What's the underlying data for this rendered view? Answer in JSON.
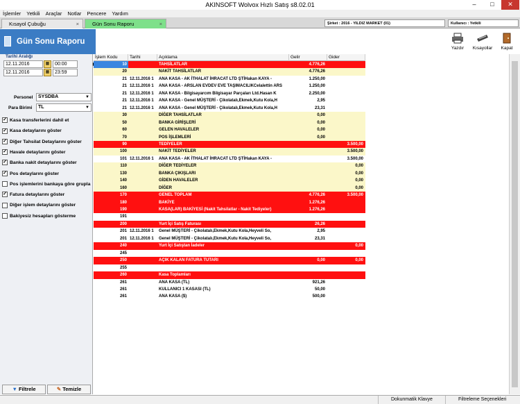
{
  "window": {
    "title": "AKINSOFT Wolvox Hızlı Satış s8.02.01",
    "minimize": "–",
    "maximize": "□",
    "close": "✕"
  },
  "menu": [
    "İşlemler",
    "Yetkili",
    "Araçlar",
    "Notlar",
    "Pencere",
    "Yardım"
  ],
  "tabs": [
    {
      "label": "Kısayol Çubuğu",
      "close": "×"
    },
    {
      "label": "Gün Sonu Raporu",
      "close": "×"
    }
  ],
  "info": {
    "company": "Şirket : 2016 - YILDIZ MARKET (01)",
    "user": "Kullanıcı : Yetkili"
  },
  "banner": {
    "title": "Gün Sonu Raporu"
  },
  "toolbar": {
    "print": "Yazdır",
    "shortcuts": "Kısayollar",
    "close": "Kapat"
  },
  "filters": {
    "date_range_label": "Tarihi Aralığı",
    "start_date": "12.11.2016",
    "start_time": "00:00",
    "end_date": "12.11.2016",
    "end_time": "23:59",
    "personnel_label": "Personel",
    "personnel_value": "SYSDBA",
    "currency_label": "Para Birimi",
    "currency_value": "TL",
    "options": [
      {
        "label": "Kasa transferlerini dahil et",
        "checked": true
      },
      {
        "label": "Kasa detaylarını göster",
        "checked": true
      },
      {
        "label": "Diğer Tahsilat Detaylarını göster",
        "checked": true
      },
      {
        "label": "Havale detaylarını göster",
        "checked": true
      },
      {
        "label": "Banka nakit detaylarını göster",
        "checked": true
      },
      {
        "label": "Pos detaylarını göster",
        "checked": true
      },
      {
        "label": "Pos işlemlerini bankaya göre grupla",
        "checked": false
      },
      {
        "label": "Fatura detaylarını göster",
        "checked": true
      },
      {
        "label": "Diğer işlem detaylarını göster",
        "checked": false
      },
      {
        "label": "Bakiyesiz hesapları gösterme",
        "checked": false
      }
    ],
    "filter_button": "Filtrele",
    "clear_button": "Temizle"
  },
  "grid": {
    "columns": {
      "code": "İşlem Kodu",
      "date": "Tarihi",
      "desc": "Açıklama",
      "gelir": "Gelir",
      "gider": "Gider"
    },
    "rows": [
      {
        "code": "10",
        "date": "",
        "desc": "TAHSİLATLAR",
        "gelir": "4.776,26",
        "gider": "",
        "style": "red",
        "selected": true
      },
      {
        "code": "20",
        "date": "",
        "desc": "NAKİT TAHSİLATLAR",
        "gelir": "4.776,26",
        "gider": "",
        "style": "yel"
      },
      {
        "code": "21",
        "date": "12.11.2016 1",
        "desc": "ANA KASA - AK İTHALAT İHRACAT LTD ŞTİHakan KAYA -",
        "gelir": "1.250,00",
        "gider": "",
        "style": "wht"
      },
      {
        "code": "21",
        "date": "12.11.2016 1",
        "desc": "ANA KASA - ARSLAN EVDEV EVE TAŞIMACILIKCelalettin ARS",
        "gelir": "1.250,00",
        "gider": "",
        "style": "wht"
      },
      {
        "code": "21",
        "date": "12.11.2016 1",
        "desc": "ANA KASA - Bilgisayarcım Bilgisayar Parçaları Ltd.Hasan K",
        "gelir": "2.250,00",
        "gider": "",
        "style": "wht"
      },
      {
        "code": "21",
        "date": "12.11.2016 1",
        "desc": "ANA KASA - Genel MÜŞTERİ - Çikolatalı,Ekmek,Kutu Kola,H",
        "gelir": "2,95",
        "gider": "",
        "style": "wht"
      },
      {
        "code": "21",
        "date": "12.11.2016 1",
        "desc": "ANA KASA - Genel MÜŞTERİ - Çikolatalı,Ekmek,Kutu Kola,H",
        "gelir": "23,31",
        "gider": "",
        "style": "wht"
      },
      {
        "code": "30",
        "date": "",
        "desc": "DİĞER TAHSİLATLAR",
        "gelir": "0,00",
        "gider": "",
        "style": "yel"
      },
      {
        "code": "50",
        "date": "",
        "desc": "BANKA GİRİŞLERİ",
        "gelir": "0,00",
        "gider": "",
        "style": "yel"
      },
      {
        "code": "60",
        "date": "",
        "desc": "GELEN HAVALELER",
        "gelir": "0,00",
        "gider": "",
        "style": "yel"
      },
      {
        "code": "70",
        "date": "",
        "desc": "POS İŞLEMLERİ",
        "gelir": "0,00",
        "gider": "",
        "style": "yel"
      },
      {
        "code": "90",
        "date": "",
        "desc": "TEDİYELER",
        "gelir": "",
        "gider": "3.500,00",
        "style": "red"
      },
      {
        "code": "100",
        "date": "",
        "desc": "NAKİT TEDİYELER",
        "gelir": "",
        "gider": "3.500,00",
        "style": "yel"
      },
      {
        "code": "101",
        "date": "12.11.2016 1",
        "desc": "ANA KASA - AK İTHALAT İHRACAT LTD ŞTİHakan KAYA -",
        "gelir": "",
        "gider": "3.500,00",
        "style": "wht"
      },
      {
        "code": "110",
        "date": "",
        "desc": "DİĞER TEDİYELER",
        "gelir": "",
        "gider": "0,00",
        "style": "yel"
      },
      {
        "code": "130",
        "date": "",
        "desc": "BANKA ÇIKIŞLARI",
        "gelir": "",
        "gider": "0,00",
        "style": "yel"
      },
      {
        "code": "140",
        "date": "",
        "desc": "GİDEN HAVALELER",
        "gelir": "",
        "gider": "0,00",
        "style": "yel"
      },
      {
        "code": "160",
        "date": "",
        "desc": "DİĞER",
        "gelir": "",
        "gider": "0,00",
        "style": "yel"
      },
      {
        "code": "170",
        "date": "",
        "desc": "GENEL TOPLAM",
        "gelir": "4.776,26",
        "gider": "3.500,00",
        "style": "red"
      },
      {
        "code": "180",
        "date": "",
        "desc": "BAKİYE",
        "gelir": "1.276,26",
        "gider": "",
        "style": "red"
      },
      {
        "code": "190",
        "date": "",
        "desc": "KASA(LAR) BAKİYESİ (Nakit Tahsilatlar - Nakit Tediyeler)",
        "gelir": "1.276,26",
        "gider": "",
        "style": "red"
      },
      {
        "code": "191",
        "date": "",
        "desc": "",
        "gelir": "",
        "gider": "",
        "style": "wht"
      },
      {
        "code": "200",
        "date": "",
        "desc": "Yurt İçi Satış Faturası",
        "gelir": "26,26",
        "gider": "",
        "style": "red"
      },
      {
        "code": "201",
        "date": "12.11.2016 1",
        "desc": "Genel MÜŞTERİ - Çikolatalı,Ekmek,Kutu Kola,Heyveli So,",
        "gelir": "2,95",
        "gider": "",
        "style": "wht"
      },
      {
        "code": "201",
        "date": "12.11.2016 1",
        "desc": "Genel MÜŞTERİ - Çikolatalı,Ekmek,Kutu Kola,Heyveli So,",
        "gelir": "23,31",
        "gider": "",
        "style": "wht"
      },
      {
        "code": "240",
        "date": "",
        "desc": "Yurt İçi Satıştan İadeler",
        "gelir": "",
        "gider": "0,00",
        "style": "red"
      },
      {
        "code": "245",
        "date": "",
        "desc": "",
        "gelir": "",
        "gider": "",
        "style": "wht"
      },
      {
        "code": "250",
        "date": "",
        "desc": "AÇIK KALAN FATURA TUTARI",
        "gelir": "0,00",
        "gider": "0,00",
        "style": "red"
      },
      {
        "code": "255",
        "date": "",
        "desc": "",
        "gelir": "",
        "gider": "",
        "style": "wht"
      },
      {
        "code": "260",
        "date": "",
        "desc": "Kasa Toplamları",
        "gelir": "",
        "gider": "",
        "style": "red"
      },
      {
        "code": "261",
        "date": "",
        "desc": "ANA KASA (TL)",
        "gelir": "921,26",
        "gider": "",
        "style": "wht"
      },
      {
        "code": "261",
        "date": "",
        "desc": "KULLANICI 1 KASASI (TL)",
        "gelir": "50,00",
        "gider": "",
        "style": "wht"
      },
      {
        "code": "261",
        "date": "",
        "desc": "ANA KASA ($)",
        "gelir": "500,00",
        "gider": "",
        "style": "wht"
      }
    ]
  },
  "statusbar": {
    "touch_keyboard": "Dokunmatik Klavye",
    "filter_options": "Filtreleme Seçenekleri"
  }
}
